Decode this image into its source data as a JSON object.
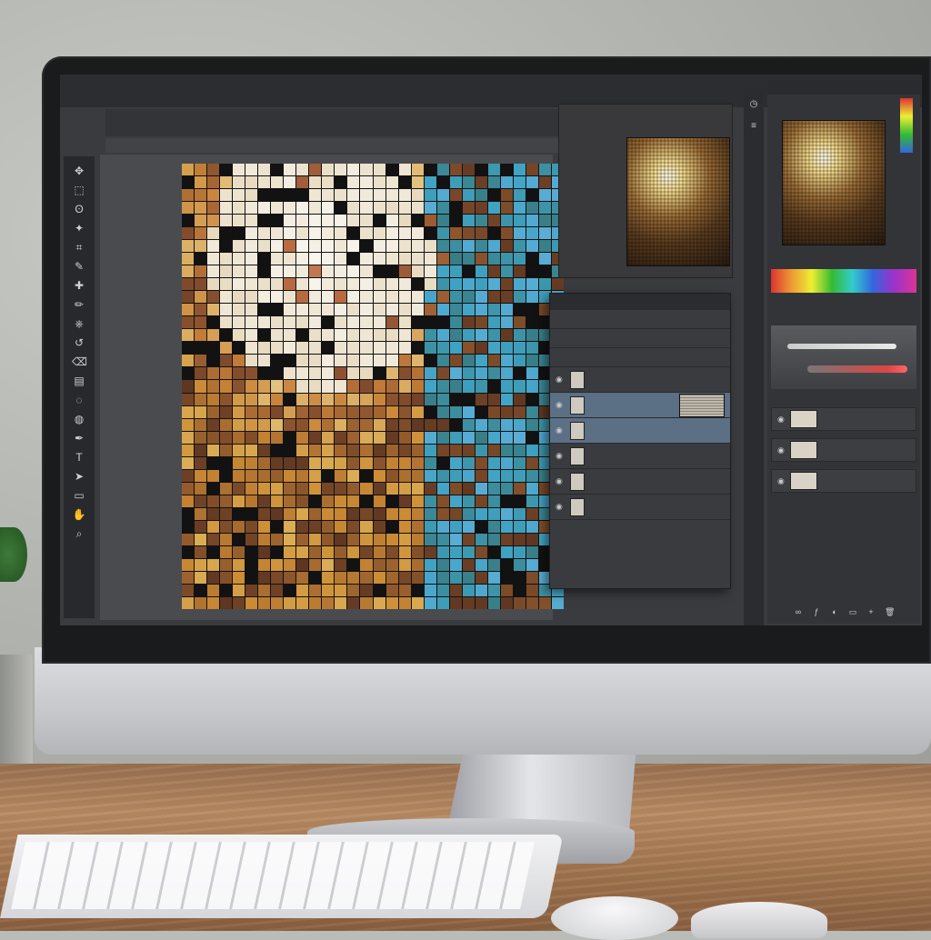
{
  "menubar": {
    "items": []
  },
  "optionsbar": {
    "items": []
  },
  "document": {
    "tab_title": ""
  },
  "toolbar": {
    "tools": [
      "move-tool-icon",
      "marquee-tool-icon",
      "lasso-tool-icon",
      "magic-wand-icon",
      "crop-tool-icon",
      "eyedropper-icon",
      "healing-brush-icon",
      "brush-tool-icon",
      "clone-stamp-icon",
      "history-brush-icon",
      "eraser-icon",
      "gradient-tool-icon",
      "blur-tool-icon",
      "dodge-tool-icon",
      "pen-tool-icon",
      "type-tool-icon",
      "path-selection-icon",
      "shape-tool-icon",
      "hand-tool-icon",
      "zoom-tool-icon"
    ]
  },
  "layers_panel": {
    "title": "",
    "layers": [
      {
        "label": "",
        "visible": true,
        "selected": false
      },
      {
        "label": "",
        "visible": true,
        "selected": true
      },
      {
        "label": "",
        "visible": true,
        "selected": true
      },
      {
        "label": "",
        "visible": true,
        "selected": false
      },
      {
        "label": "",
        "visible": true,
        "selected": false
      },
      {
        "label": "",
        "visible": true,
        "selected": false
      }
    ]
  },
  "right_panel": {
    "header": "",
    "rows": [
      {
        "label": ""
      },
      {
        "label": ""
      },
      {
        "label": ""
      }
    ]
  },
  "colors": {
    "ui_dark": "#2c2d30",
    "ui_panel": "#3a3b3e",
    "selection": "#5b6f85",
    "mosaic_highlight": "#f4e9cf",
    "mosaic_warm": "#8a4a24",
    "mosaic_teal": "#3f7d86"
  }
}
